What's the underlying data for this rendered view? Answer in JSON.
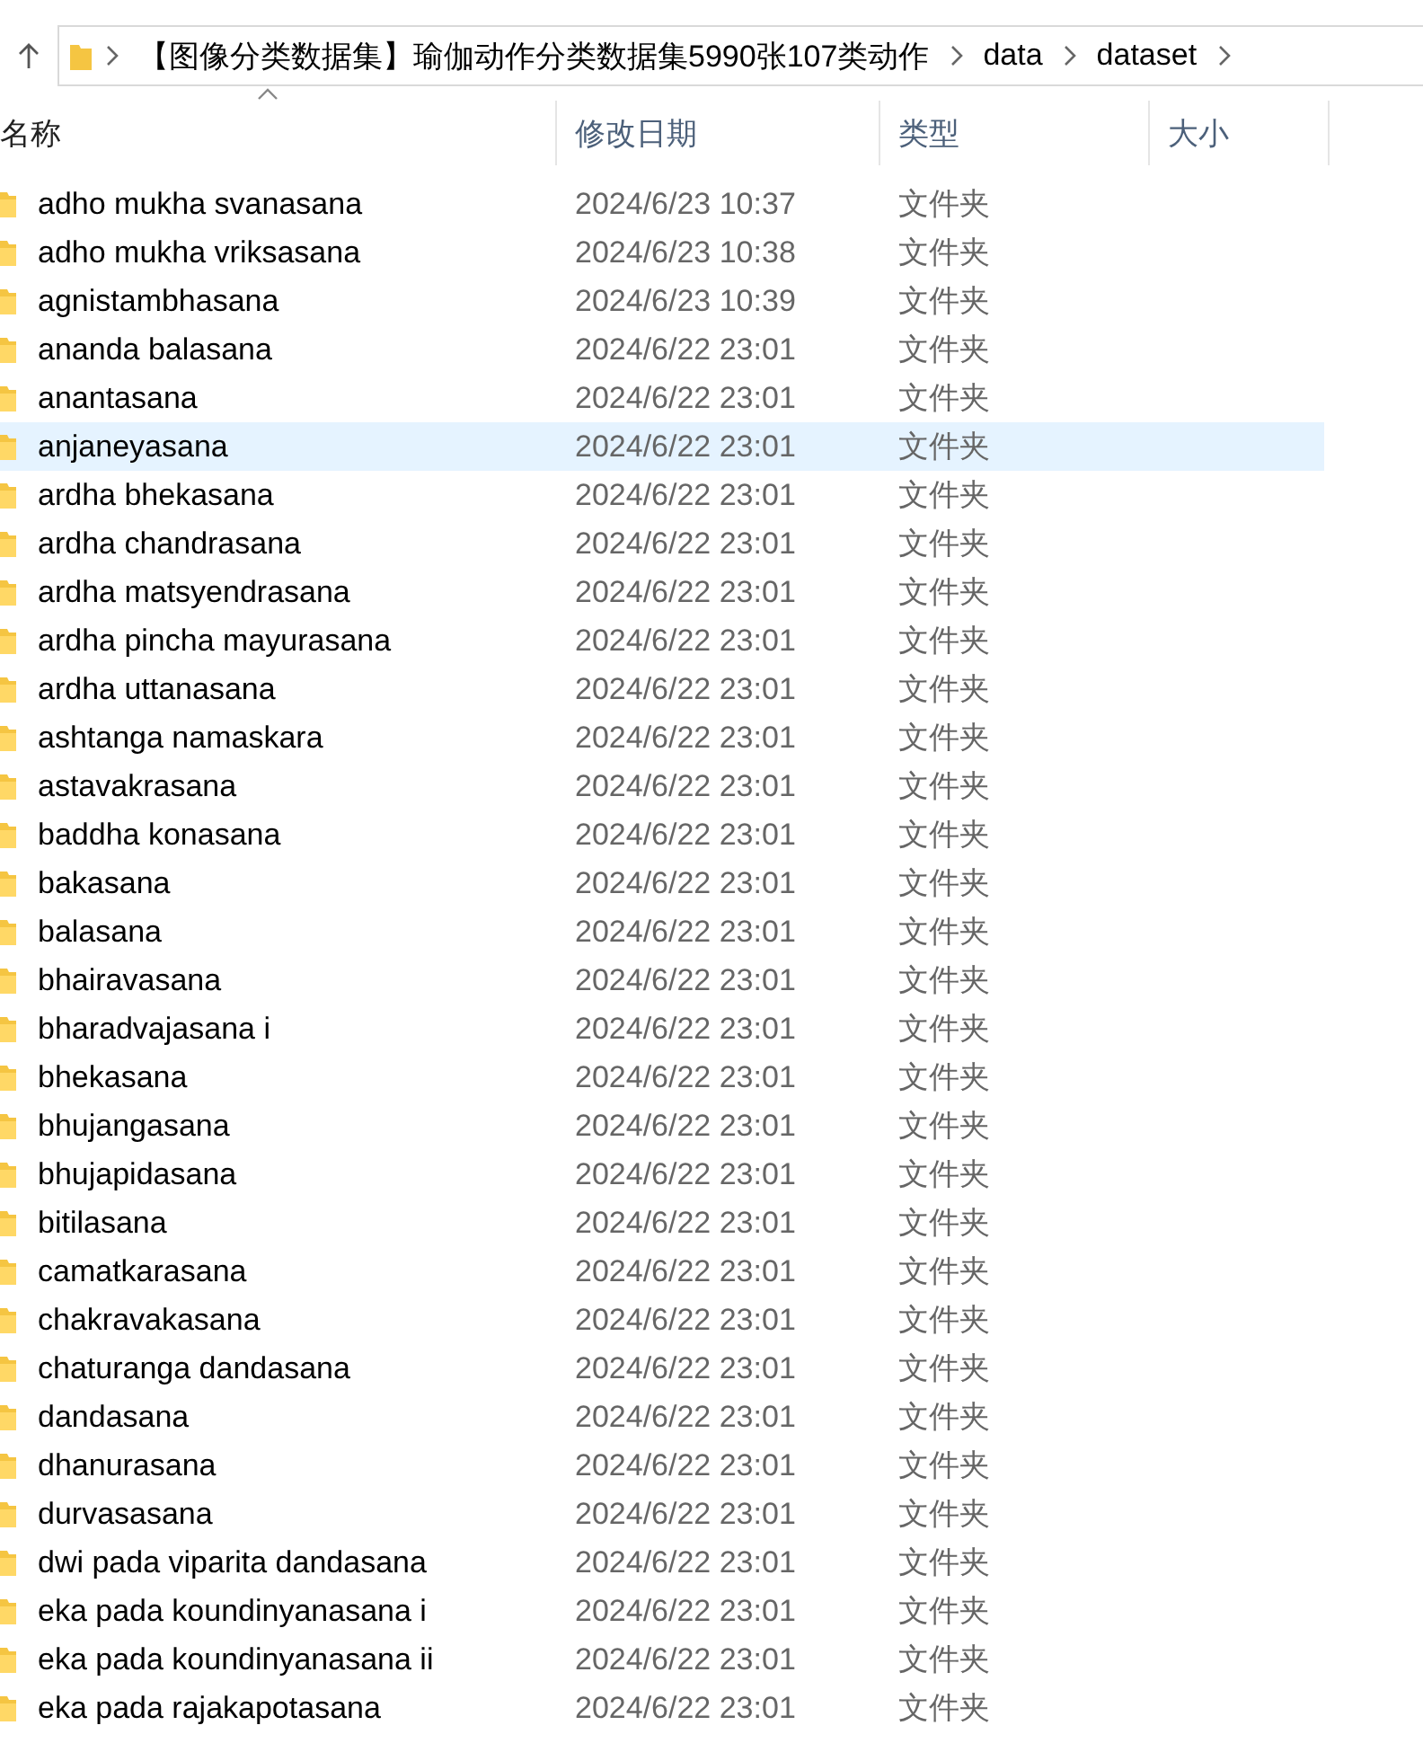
{
  "breadcrumb": [
    "【图像分类数据集】瑜伽动作分类数据集5990张107类动作",
    "data",
    "dataset"
  ],
  "columns": [
    {
      "label": "名称",
      "sorted": true
    },
    {
      "label": "修改日期",
      "sorted": false
    },
    {
      "label": "类型",
      "sorted": false
    },
    {
      "label": "大小",
      "sorted": false
    }
  ],
  "rows": [
    {
      "name": "adho mukha svanasana",
      "modified": "2024/6/23 10:37",
      "type": "文件夹",
      "selected": false
    },
    {
      "name": "adho mukha vriksasana",
      "modified": "2024/6/23 10:38",
      "type": "文件夹",
      "selected": false
    },
    {
      "name": "agnistambhasana",
      "modified": "2024/6/23 10:39",
      "type": "文件夹",
      "selected": false
    },
    {
      "name": "ananda balasana",
      "modified": "2024/6/22 23:01",
      "type": "文件夹",
      "selected": false
    },
    {
      "name": "anantasana",
      "modified": "2024/6/22 23:01",
      "type": "文件夹",
      "selected": false
    },
    {
      "name": "anjaneyasana",
      "modified": "2024/6/22 23:01",
      "type": "文件夹",
      "selected": true
    },
    {
      "name": "ardha bhekasana",
      "modified": "2024/6/22 23:01",
      "type": "文件夹",
      "selected": false
    },
    {
      "name": "ardha chandrasana",
      "modified": "2024/6/22 23:01",
      "type": "文件夹",
      "selected": false
    },
    {
      "name": "ardha matsyendrasana",
      "modified": "2024/6/22 23:01",
      "type": "文件夹",
      "selected": false
    },
    {
      "name": "ardha pincha mayurasana",
      "modified": "2024/6/22 23:01",
      "type": "文件夹",
      "selected": false
    },
    {
      "name": "ardha uttanasana",
      "modified": "2024/6/22 23:01",
      "type": "文件夹",
      "selected": false
    },
    {
      "name": "ashtanga namaskara",
      "modified": "2024/6/22 23:01",
      "type": "文件夹",
      "selected": false
    },
    {
      "name": "astavakrasana",
      "modified": "2024/6/22 23:01",
      "type": "文件夹",
      "selected": false
    },
    {
      "name": "baddha konasana",
      "modified": "2024/6/22 23:01",
      "type": "文件夹",
      "selected": false
    },
    {
      "name": "bakasana",
      "modified": "2024/6/22 23:01",
      "type": "文件夹",
      "selected": false
    },
    {
      "name": "balasana",
      "modified": "2024/6/22 23:01",
      "type": "文件夹",
      "selected": false
    },
    {
      "name": "bhairavasana",
      "modified": "2024/6/22 23:01",
      "type": "文件夹",
      "selected": false
    },
    {
      "name": "bharadvajasana i",
      "modified": "2024/6/22 23:01",
      "type": "文件夹",
      "selected": false
    },
    {
      "name": "bhekasana",
      "modified": "2024/6/22 23:01",
      "type": "文件夹",
      "selected": false
    },
    {
      "name": "bhujangasana",
      "modified": "2024/6/22 23:01",
      "type": "文件夹",
      "selected": false
    },
    {
      "name": "bhujapidasana",
      "modified": "2024/6/22 23:01",
      "type": "文件夹",
      "selected": false
    },
    {
      "name": "bitilasana",
      "modified": "2024/6/22 23:01",
      "type": "文件夹",
      "selected": false
    },
    {
      "name": "camatkarasana",
      "modified": "2024/6/22 23:01",
      "type": "文件夹",
      "selected": false
    },
    {
      "name": "chakravakasana",
      "modified": "2024/6/22 23:01",
      "type": "文件夹",
      "selected": false
    },
    {
      "name": "chaturanga dandasana",
      "modified": "2024/6/22 23:01",
      "type": "文件夹",
      "selected": false
    },
    {
      "name": "dandasana",
      "modified": "2024/6/22 23:01",
      "type": "文件夹",
      "selected": false
    },
    {
      "name": "dhanurasana",
      "modified": "2024/6/22 23:01",
      "type": "文件夹",
      "selected": false
    },
    {
      "name": "durvasasana",
      "modified": "2024/6/22 23:01",
      "type": "文件夹",
      "selected": false
    },
    {
      "name": "dwi pada viparita dandasana",
      "modified": "2024/6/22 23:01",
      "type": "文件夹",
      "selected": false
    },
    {
      "name": "eka pada koundinyanasana i",
      "modified": "2024/6/22 23:01",
      "type": "文件夹",
      "selected": false
    },
    {
      "name": "eka pada koundinyanasana ii",
      "modified": "2024/6/22 23:01",
      "type": "文件夹",
      "selected": false
    },
    {
      "name": "eka pada rajakapotasana",
      "modified": "2024/6/22 23:01",
      "type": "文件夹",
      "selected": false
    }
  ]
}
